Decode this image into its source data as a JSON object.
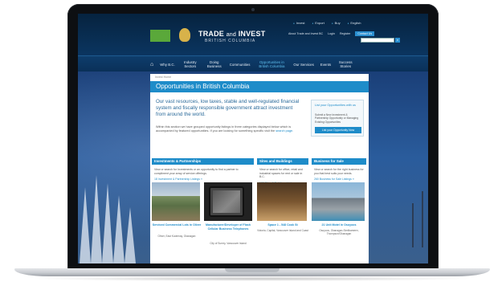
{
  "site": {
    "logo_text": "TRADE AND INVEST BRITISH COLUMBIA",
    "brand_line1_main": "TRADE",
    "brand_line1_and": "and",
    "brand_line1_end": "INVEST",
    "brand_line2": "BRITISH COLUMBIA"
  },
  "top_links": [
    "Invest",
    "Export",
    "Buy",
    "English"
  ],
  "util_links": [
    "About Trade and Invest BC",
    "Login",
    "Register",
    "Contact Us"
  ],
  "nav": {
    "items": [
      {
        "label": "Why B.C."
      },
      {
        "label": "Industry Sectors"
      },
      {
        "label": "Doing Business"
      },
      {
        "label": "Communities"
      },
      {
        "label": "Opportunities in British Columbia"
      },
      {
        "label": "Our Services"
      },
      {
        "label": "Events"
      },
      {
        "label": "Success Stories"
      }
    ],
    "active_index": 4
  },
  "page": {
    "breadcrumb": "Invest Home",
    "title": "Opportunities in British Columbia",
    "lead": "Our vast resources, low taxes, stable and well-regulated financial system and fiscally responsible government attract investment from around the world.",
    "body": "Within this section we have grouped opportunity listings in three categories displayed below which is accompanied by featured opportunities. If you are looking for something specific visit the",
    "body_link": "search page."
  },
  "sidebox": {
    "title": "List your Opportunities with us",
    "desc": "Submit a New Investment & Partnership Opportunity or Managing Existing Opportunities",
    "button": "List your Opportunity Now"
  },
  "cards": [
    {
      "heading": "Investments & Partnerships",
      "desc": "View or search for Investments or an opportunity to find a partner to compliment your array of service offerings.",
      "link": "18 Investment & Partnership Listings »",
      "features": [
        {
          "caption": "Serviced Commercial Lots in Oliver",
          "sub": "Oliver, East Kootenay, Okanagan"
        },
        {
          "caption": "Manufacturer/Developer of Flash Cellular Business Telephones",
          "sub": "City of Surrey, Vancouver Island"
        }
      ]
    },
    {
      "heading": "Sites and Buildings",
      "desc": "View or search for office, retail and industrial spaces for rent or sale in B.C.",
      "link": "100 Sites & Buildings Listings »",
      "features": [
        {
          "caption": "Space 1 - 548 Cook St",
          "sub": "Victoria, Capital, Vancouver Island and Coast"
        }
      ]
    },
    {
      "heading": "Business for Sale",
      "desc": "View or search for the right business for you that best suits your needs.",
      "link": "260 Business for Sale Listings »",
      "features": [
        {
          "caption": "21 Unit Motel in Osoyoos",
          "sub": "Osoyoos, Okanagan-Similkameen, Thompson/Okanagan"
        }
      ]
    }
  ]
}
